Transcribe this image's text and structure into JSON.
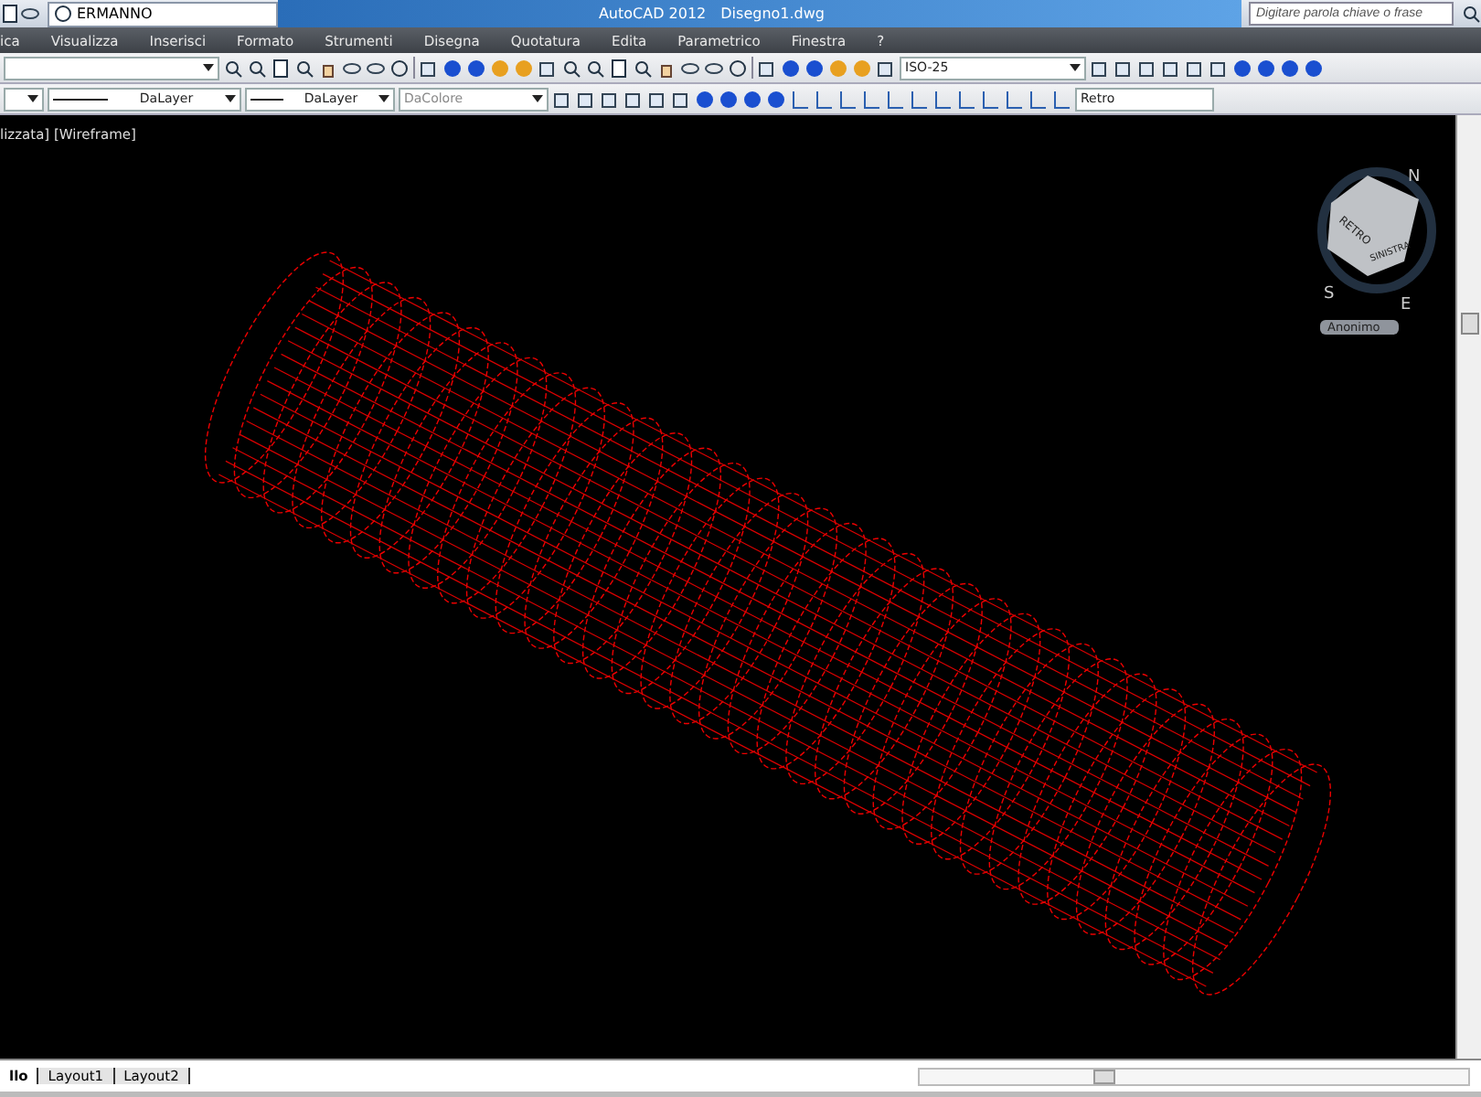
{
  "quick_access": {
    "workspace": "ERMANNO"
  },
  "window": {
    "title": "AutoCAD 2012",
    "document": "Disegno1.dwg"
  },
  "search": {
    "placeholder": "Digitare parola chiave o frase"
  },
  "menu": [
    "ica",
    "Visualizza",
    "Inserisci",
    "Formato",
    "Strumenti",
    "Disegna",
    "Quotatura",
    "Edita",
    "Parametrico",
    "Finestra",
    "?"
  ],
  "properties": {
    "linetype": "DaLayer",
    "lineweight": "DaLayer",
    "color_setting": "DaColore"
  },
  "dimension_style": "ISO-25",
  "view": "Retro",
  "viewport": {
    "label": "lizzata] [Wireframe]"
  },
  "viewcube": {
    "faces": [
      "RETRO",
      "SINISTRA"
    ],
    "compass": [
      "N",
      "S",
      "E"
    ],
    "ucs": "Anonimo"
  },
  "layout_tabs": [
    {
      "label": "llo",
      "selected": true
    },
    {
      "label": "Layout1",
      "selected": false
    },
    {
      "label": "Layout2",
      "selected": false
    }
  ]
}
